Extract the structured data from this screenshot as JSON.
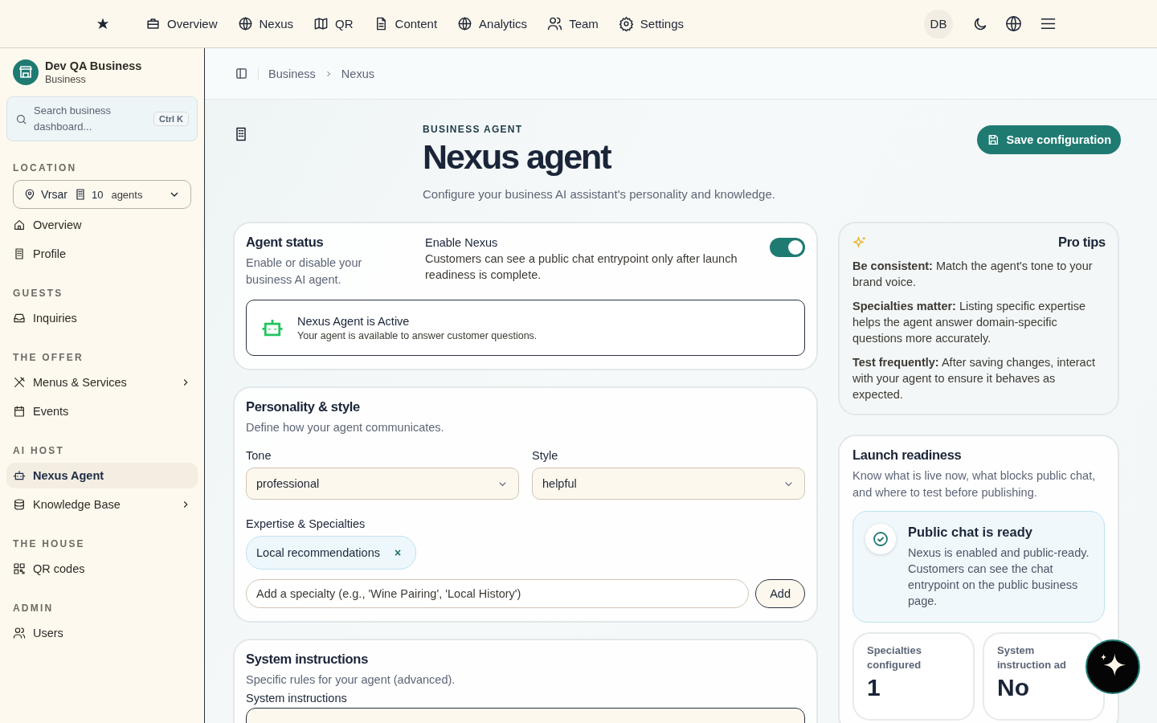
{
  "top_nav": {
    "items": [
      {
        "label": "Overview",
        "selected": false
      },
      {
        "label": "Nexus",
        "selected": false
      },
      {
        "label": "QR",
        "selected": false
      },
      {
        "label": "Content",
        "selected": false
      },
      {
        "label": "Analytics",
        "selected": false
      },
      {
        "label": "Team",
        "selected": false
      },
      {
        "label": "Settings",
        "selected": false
      }
    ],
    "avatar": "DB"
  },
  "sidebar": {
    "business_name": "Dev QA Business",
    "business_type": "Business",
    "search": {
      "placeholder": "Search business dashboard...",
      "shortcut": "Ctrl K"
    },
    "location": {
      "heading": "LOCATION",
      "name": "Vrsar",
      "count": "10",
      "unit": "agents"
    },
    "sections": [
      {
        "items": [
          {
            "label": "Overview",
            "selected": false
          },
          {
            "label": "Profile",
            "selected": false
          }
        ]
      },
      {
        "heading": "GUESTS",
        "items": [
          {
            "label": "Inquiries",
            "selected": false
          }
        ]
      },
      {
        "heading": "THE OFFER",
        "items": [
          {
            "label": "Menus & Services",
            "selected": false,
            "expanded": false
          },
          {
            "label": "Events",
            "selected": false
          }
        ]
      },
      {
        "heading": "AI HOST",
        "items": [
          {
            "label": "Nexus Agent",
            "selected": true
          },
          {
            "label": "Knowledge Base",
            "selected": false,
            "expanded": false
          }
        ]
      },
      {
        "heading": "THE HOUSE",
        "items": [
          {
            "label": "QR codes",
            "selected": false
          }
        ]
      },
      {
        "heading": "ADMIN",
        "items": [
          {
            "label": "Users",
            "selected": false
          }
        ]
      }
    ]
  },
  "breadcrumb": [
    "Business",
    "Nexus"
  ],
  "header": {
    "eyebrow": "BUSINESS AGENT",
    "title": "Nexus agent",
    "subtitle": "Configure your business AI assistant's personality and knowledge.",
    "save_button": "Save configuration"
  },
  "agent_status": {
    "title": "Agent status",
    "description": "Enable or disable your business AI agent.",
    "toggle_label": "Enable Nexus",
    "toggle_description": "Customers can see a public chat entrypoint only after launch readiness is complete.",
    "on": true,
    "status_title": "Nexus Agent is Active",
    "status_text": "Your agent is available to answer customer questions."
  },
  "personality": {
    "title": "Personality & style",
    "description": "Define how your agent communicates.",
    "tone_label": "Tone",
    "tone": "professional",
    "style_label": "Style",
    "style": "helpful",
    "specialties_label": "Expertise & Specialties",
    "specialties": [
      "Local recommendations"
    ],
    "remove_mark": "×",
    "add_placeholder": "Add a specialty (e.g., 'Wine Pairing', 'Local History')",
    "add_button": "Add"
  },
  "system_instructions": {
    "title": "System instructions",
    "description": "Specific rules for your agent (advanced).",
    "field_label": "System instructions"
  },
  "pro_tips": {
    "title": "Pro tips",
    "tips": [
      {
        "lead": "Be consistent:",
        "text": "Match the agent's tone to your brand voice."
      },
      {
        "lead": "Specialties matter:",
        "text": "Listing specific expertise helps the agent answer domain-specific questions more accurately."
      },
      {
        "lead": "Test frequently:",
        "text": "After saving changes, interact with your agent to ensure it behaves as expected."
      }
    ]
  },
  "launch_readiness": {
    "title": "Launch readiness",
    "description": "Know what is live now, what blocks public chat, and where to test before publishing.",
    "status_title": "Public chat is ready",
    "status_text": "Nexus is enabled and public-ready. Customers can see the chat entrypoint on the public business page.",
    "stats": [
      {
        "label": "Specialties configured",
        "value": "1"
      },
      {
        "label": "System instruction ad",
        "value": "No"
      }
    ]
  }
}
